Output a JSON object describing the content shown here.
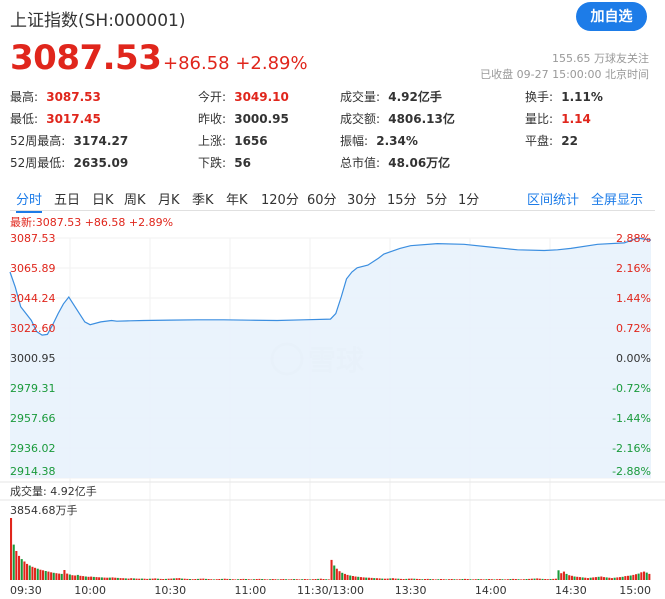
{
  "header": {
    "title": "上证指数(SH:000001)",
    "follow_label": "加自选",
    "price": "3087.53",
    "change": "+86.58 +2.89%",
    "followers": "155.65 万球友关注",
    "status": "已收盘 09-27 15:00:00 北京时间"
  },
  "stats": [
    {
      "label": "最高:",
      "value": "3087.53",
      "tone": "red"
    },
    {
      "label": "今开:",
      "value": "3049.10",
      "tone": "red"
    },
    {
      "label": "成交量:",
      "value": "4.92亿手",
      "tone": ""
    },
    {
      "label": "换手:",
      "value": "1.11%",
      "tone": ""
    },
    {
      "label": "最低:",
      "value": "3017.45",
      "tone": "red"
    },
    {
      "label": "昨收:",
      "value": "3000.95",
      "tone": ""
    },
    {
      "label": "成交额:",
      "value": "4806.13亿",
      "tone": ""
    },
    {
      "label": "量比:",
      "value": "1.14",
      "tone": "red"
    },
    {
      "label": "52周最高:",
      "value": "3174.27",
      "tone": ""
    },
    {
      "label": "上涨:",
      "value": "1656",
      "tone": ""
    },
    {
      "label": "振幅:",
      "value": "2.34%",
      "tone": ""
    },
    {
      "label": "平盘:",
      "value": "22",
      "tone": ""
    },
    {
      "label": "52周最低:",
      "value": "2635.09",
      "tone": ""
    },
    {
      "label": "下跌:",
      "value": "56",
      "tone": ""
    },
    {
      "label": "总市值:",
      "value": "48.06万亿",
      "tone": ""
    }
  ],
  "tabs": [
    "分时",
    "五日",
    "日K",
    "周K",
    "月K",
    "季K",
    "年K",
    "120分",
    "60分",
    "30分",
    "15分",
    "5分",
    "1分"
  ],
  "tabs_right": [
    "区间统计",
    "全屏显示"
  ],
  "watermark": "雪球",
  "colors": {
    "up": "#e0261c",
    "down": "#1a9a3b",
    "accent": "#1d7ce8",
    "line": "#3b8ee0"
  },
  "chart_data": {
    "type": "line",
    "latest_label": "最新:3087.53 +86.58 +2.89%",
    "prev_close": 3000.95,
    "ylim": [
      2914.38,
      3087.53
    ],
    "y_ticks_left": [
      "3087.53",
      "3065.89",
      "3044.24",
      "3022.60",
      "3000.95",
      "2979.31",
      "2957.66",
      "2936.02",
      "2914.38"
    ],
    "y_ticks_right": [
      "2.88%",
      "2.16%",
      "1.44%",
      "0.72%",
      "0.00%",
      "-0.72%",
      "-1.44%",
      "-2.16%",
      "-2.88%"
    ],
    "x_ticks": [
      "09:30",
      "10:00",
      "10:30",
      "11:00",
      "11:30/13:00",
      "13:30",
      "14:00",
      "14:30",
      "15:00"
    ],
    "x_count": 241,
    "x": [
      0,
      2,
      4,
      8,
      10,
      12,
      14,
      16,
      18,
      20,
      22,
      26,
      28,
      30,
      34,
      38,
      40,
      45,
      50,
      60,
      70,
      80,
      90,
      100,
      110,
      120,
      122,
      124,
      126,
      128,
      130,
      134,
      138,
      140,
      146,
      150,
      160,
      170,
      180,
      190,
      200,
      205,
      210,
      220,
      230,
      235,
      240
    ],
    "y": [
      3063,
      3052,
      3038,
      3028,
      3020,
      3017.45,
      3018,
      3025,
      3033,
      3040,
      3045,
      3033,
      3027,
      3025,
      3027,
      3028,
      3027.5,
      3027.8,
      3028,
      3028.3,
      3028.5,
      3028.5,
      3028.2,
      3028,
      3028.5,
      3029,
      3033,
      3045,
      3058,
      3063,
      3066,
      3068,
      3073,
      3076,
      3080,
      3082,
      3083.5,
      3083,
      3081,
      3079,
      3078.5,
      3079,
      3080,
      3083,
      3084,
      3087.5,
      3086
    ],
    "volume_label": "成交量: 4.92亿手",
    "volume_max_label": "3854.68万手",
    "volume_max": 3854.68,
    "volume_bins": [
      3854.68,
      2200,
      1800,
      1500,
      1300,
      1150,
      1000,
      900,
      820,
      760,
      700,
      640,
      600,
      560,
      520,
      480,
      450,
      420,
      400,
      380,
      620,
      400,
      340,
      300,
      280,
      320,
      260,
      240,
      220,
      200,
      210,
      190,
      180,
      170,
      160,
      150,
      140,
      150,
      160,
      140,
      130,
      120,
      110,
      100,
      90,
      110,
      100,
      90,
      80,
      90,
      80,
      70,
      80,
      90,
      100,
      80,
      70,
      60,
      70,
      80,
      90,
      100,
      110,
      120,
      90,
      80,
      70,
      60,
      50,
      60,
      70,
      80,
      90,
      70,
      60,
      50,
      40,
      50,
      60,
      70,
      80,
      70,
      60,
      50,
      40,
      50,
      60,
      70,
      60,
      50,
      40,
      50,
      60,
      70,
      60,
      50,
      40,
      50,
      60,
      50,
      40,
      50,
      60,
      50,
      40,
      50,
      60,
      50,
      40,
      50,
      60,
      50,
      40,
      50,
      60,
      70,
      80,
      60,
      50,
      40,
      1250,
      900,
      700,
      550,
      450,
      380,
      320,
      280,
      250,
      220,
      200,
      180,
      160,
      150,
      140,
      130,
      120,
      110,
      100,
      90,
      80,
      90,
      100,
      110,
      90,
      80,
      70,
      60,
      70,
      80,
      90,
      80,
      70,
      60,
      50,
      60,
      70,
      60,
      50,
      40,
      50,
      60,
      50,
      40,
      50,
      60,
      50,
      40,
      50,
      60,
      70,
      60,
      50,
      40,
      50,
      60,
      50,
      40,
      50,
      60,
      50,
      40,
      50,
      60,
      50,
      40,
      50,
      60,
      70,
      60,
      50,
      40,
      50,
      60,
      70,
      80,
      90,
      100,
      80,
      70,
      60,
      50,
      60,
      70,
      80,
      600,
      420,
      520,
      380,
      300,
      260,
      220,
      200,
      180,
      160,
      140,
      120,
      140,
      160,
      180,
      200,
      220,
      180,
      160,
      140,
      120,
      140,
      160,
      180,
      200,
      240,
      260,
      280,
      320,
      360,
      400,
      480,
      520,
      460,
      380
    ]
  }
}
